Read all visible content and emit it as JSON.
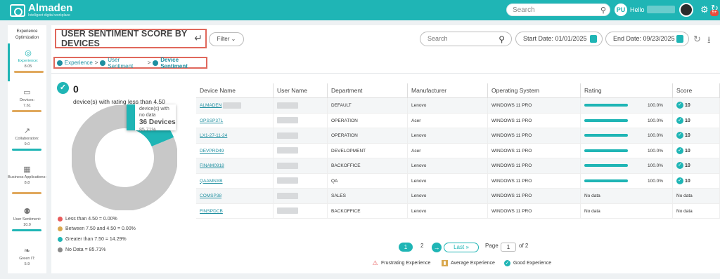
{
  "app": {
    "name": "Almaden",
    "tagline": "Intelligent digital workplace"
  },
  "topbar": {
    "search_placeholder": "Search",
    "user_initials": "PU",
    "hello": "Hello",
    "notification_count": "5+"
  },
  "sidebar": {
    "title": "Experience Optimization",
    "items": [
      {
        "label": "Experience:",
        "value": "8.05",
        "bar_color": "#e0a85c",
        "icon": "globe-icon"
      },
      {
        "label": "Devices:",
        "value": "7.61",
        "bar_color": "#e0a85c",
        "icon": "laptop-icon"
      },
      {
        "label": "Collaboration:",
        "value": "9.0",
        "bar_color": "#1fb5b5",
        "icon": "chart-line-icon"
      },
      {
        "label": "Business Applications:",
        "value": "8.8",
        "bar_color": "#e0a85c",
        "icon": "building-icon"
      },
      {
        "label": "User Sentiment:",
        "value": "10.0",
        "bar_color": "#1fb5b5",
        "icon": "users-icon"
      },
      {
        "label": "Green IT:",
        "value": "5.9",
        "bar_color": "#e0a85c",
        "icon": "leaf-icon"
      }
    ]
  },
  "header": {
    "title": "USER SENTIMENT SCORE BY DEVICES",
    "filter_label": "Filter",
    "search_placeholder": "Search",
    "start_date": "Start Date: 01/01/2025",
    "end_date": "End Date: 09/23/2025"
  },
  "breadcrumb": {
    "items": [
      "Experience",
      "User Sentiment"
    ],
    "current": "Device Sentiment",
    "separator": ">"
  },
  "summary": {
    "count": "0",
    "caption": "device(s) with rating less than 4.50",
    "tooltip": {
      "label": "device(s) with no data",
      "value": "36 Devices",
      "percent": "85.71%"
    },
    "donut": [
      {
        "name": "Less than 4.50",
        "percent": 0.0,
        "color": "#e85a5a"
      },
      {
        "name": "Between 7.50 and 4.50",
        "percent": 0.0,
        "color": "#d9a84e"
      },
      {
        "name": "Greater than 7.50",
        "percent": 14.29,
        "color": "#1fb5b5"
      },
      {
        "name": "No Data",
        "percent": 85.71,
        "color": "#c8c8c8"
      }
    ],
    "legend": [
      {
        "text": "Less than 4.50  = 0.00%",
        "color": "#e85a5a"
      },
      {
        "text": "Between 7.50 and 4.50  = 0.00%",
        "color": "#d9a84e"
      },
      {
        "text": "Greater than 7.50  = 14.29%",
        "color": "#1fb5b5"
      },
      {
        "text": "No Data  = 85.71%",
        "color": "#8a8a8a"
      }
    ]
  },
  "table": {
    "columns": [
      "Device Name",
      "User Name",
      "Department",
      "Manufacturer",
      "Operating System",
      "Rating",
      "Score"
    ],
    "rows": [
      {
        "device": "ALMADEN",
        "dept": "DEFAULT",
        "mfr": "Lenovo",
        "os": "WINDOWS 11 PRO",
        "rating": "100.0%",
        "rating_value": 1.0,
        "score": "10"
      },
      {
        "device": "OPSSP37L",
        "dept": "OPERATION",
        "mfr": "Acer",
        "os": "WINDOWS 11 PRO",
        "rating": "100.0%",
        "rating_value": 1.0,
        "score": "10"
      },
      {
        "device": "LX1-27-11-24",
        "dept": "OPERATION",
        "mfr": "Lenovo",
        "os": "WINDOWS 11 PRO",
        "rating": "100.0%",
        "rating_value": 1.0,
        "score": "10"
      },
      {
        "device": "DEVPRD49",
        "dept": "DEVELOPMENT",
        "mfr": "Acer",
        "os": "WINDOWS 11 PRO",
        "rating": "100.0%",
        "rating_value": 1.0,
        "score": "10"
      },
      {
        "device": "FINAM0918",
        "dept": "BACKOFFICE",
        "mfr": "Lenovo",
        "os": "WINDOWS 11 PRO",
        "rating": "100.0%",
        "rating_value": 1.0,
        "score": "10"
      },
      {
        "device": "QAAMNXB",
        "dept": "QA",
        "mfr": "Lenovo",
        "os": "WINDOWS 11 PRO",
        "rating": "100.0%",
        "rating_value": 1.0,
        "score": "10"
      },
      {
        "device": "COMSP38",
        "dept": "SALES",
        "mfr": "Lenovo",
        "os": "WINDOWS 11 PRO",
        "rating": "No data",
        "rating_value": null,
        "score": "No data"
      },
      {
        "device": "FINSPDCB",
        "dept": "BACKOFFICE",
        "mfr": "Lenovo",
        "os": "WINDOWS 11 PRO",
        "rating": "No data",
        "rating_value": null,
        "score": "No data"
      }
    ]
  },
  "pagination": {
    "page1": "1",
    "page2": "2",
    "last": "Last",
    "page_label": "Page",
    "current": "1",
    "of_total": "of 2"
  },
  "footer_legend": [
    {
      "text": "Frustrating Experience",
      "color": "#e85a5a"
    },
    {
      "text": "Average Experience",
      "color": "#d9a84e"
    },
    {
      "text": "Good Experience",
      "color": "#1fb5b5"
    }
  ]
}
